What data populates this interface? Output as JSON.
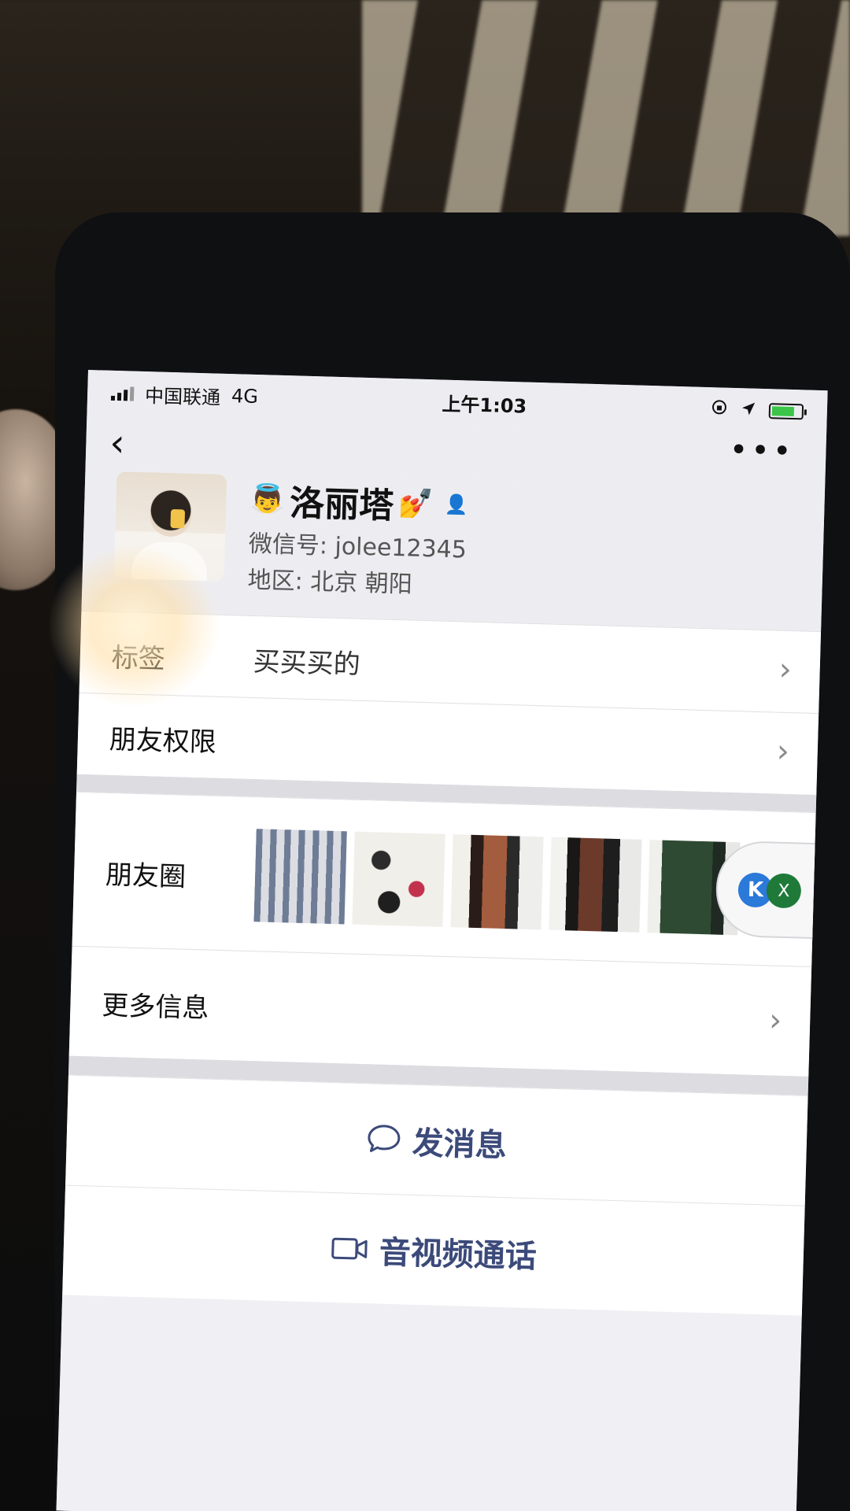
{
  "status_bar": {
    "carrier": "中国联通",
    "network": "4G",
    "time": "上午1:03",
    "icons": [
      "orientation-lock-icon",
      "location-icon",
      "battery-charging-icon"
    ]
  },
  "nav": {
    "back_icon": "‹",
    "more_icon": "•••"
  },
  "profile": {
    "name": "洛丽塔",
    "name_prefix_emoji": "👼",
    "name_suffix_emoji": "💅",
    "badge_emoji": "👤",
    "wechat_id_label": "微信号:",
    "wechat_id": "jolee12345",
    "region_label": "地区:",
    "region": "北京 朝阳"
  },
  "rows": {
    "tag": {
      "label": "标签",
      "value": "买买买的"
    },
    "permissions": {
      "label": "朋友权限"
    },
    "moments": {
      "label": "朋友圈"
    },
    "more_info": {
      "label": "更多信息"
    }
  },
  "float_bubble": {
    "k_label": "K",
    "x_label": "X"
  },
  "actions": {
    "message": "发消息",
    "call": "音视频通话"
  },
  "chevron": "›",
  "colors": {
    "action_text": "#3c4a7a",
    "screen_bg": "#efeff4",
    "group_gap": "#dcdce1"
  }
}
